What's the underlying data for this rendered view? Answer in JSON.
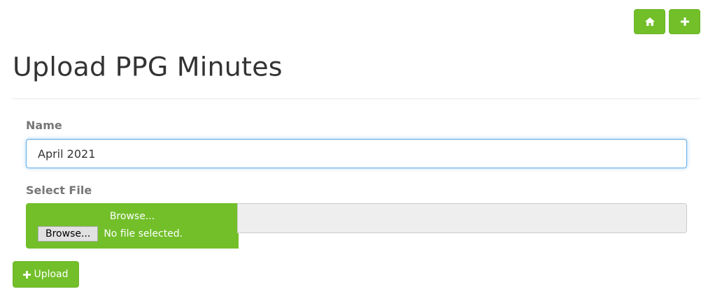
{
  "header": {
    "title": "Upload PPG Minutes",
    "actions": [
      {
        "icon": "home-icon",
        "label": ""
      },
      {
        "icon": "plus-icon",
        "label": ""
      }
    ]
  },
  "form": {
    "name": {
      "label": "Name",
      "value": "April 2021"
    },
    "file": {
      "label": "Select File",
      "browse_caption": "Browse...",
      "native_button_label": "Browse...",
      "status_text": "No file selected."
    },
    "submit": {
      "label": "Upload",
      "icon": "plus-icon"
    }
  },
  "colors": {
    "accent_green": "#72bf2a",
    "input_focus_border": "#66afe9",
    "label_gray": "#777777"
  }
}
